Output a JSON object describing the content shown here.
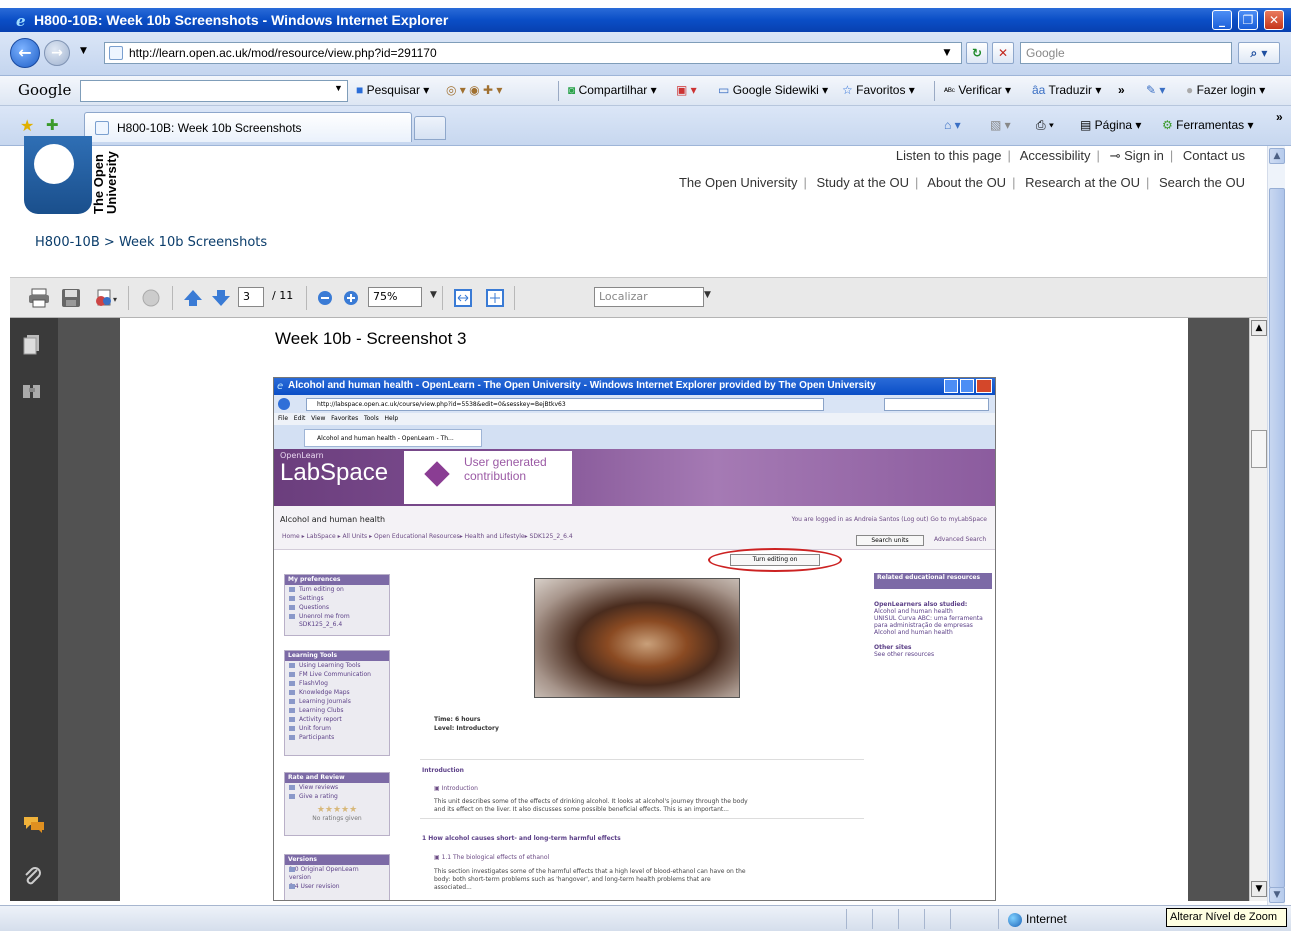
{
  "window": {
    "title": "H800-10B: Week 10b Screenshots - Windows Internet Explorer"
  },
  "address": {
    "url": "http://learn.open.ac.uk/mod/resource/view.php?id=291170",
    "search_placeholder": "Google"
  },
  "google_toolbar": {
    "logo": "Google",
    "items": [
      "Pesquisar",
      "Compartilhar",
      "Google Sidewiki",
      "Favoritos",
      "Verificar",
      "Traduzir",
      "Fazer login"
    ]
  },
  "tabs": {
    "active": "H800-10B: Week 10b Screenshots",
    "right_items": [
      "Página",
      "Ferramentas"
    ]
  },
  "ou_page": {
    "logo_text": "The Open University",
    "top_links": [
      "Listen to this page",
      "Accessibility",
      "Sign in",
      "Contact us"
    ],
    "main_links": [
      "The Open University",
      "Study at the OU",
      "About the OU",
      "Research at the OU",
      "Search the OU"
    ],
    "breadcrumb_course": "H800-10B",
    "breadcrumb_sep": ">",
    "breadcrumb_page": "Week 10b Screenshots"
  },
  "pdf_toolbar": {
    "page_current": "3",
    "page_total": "/ 11",
    "zoom": "75%",
    "find_placeholder": "Localizar"
  },
  "pdf_page": {
    "title": "Week 10b - Screenshot 3",
    "inner": {
      "window_title": "Alcohol and human health - OpenLearn - The Open University - Windows Internet Explorer provided by The Open University",
      "url": "http://labspace.open.ac.uk/course/view.php?id=5538&edit=0&sesskey=BejBtkv63",
      "menu": [
        "File",
        "Edit",
        "View",
        "Favorites",
        "Tools",
        "Help"
      ],
      "tab": "Alcohol and human health - OpenLearn - Th...",
      "brand_small": "OpenLearn",
      "brand": "LabSpace",
      "ugc": "User generated contribution",
      "course_title": "Alcohol and human health",
      "logged_in": "You are logged in as Andreia Santos (Log out)  Go to myLabSpace",
      "crumbs": "Home ▸ LabSpace ▸ All Units ▸ Open Educational Resources▸ Health and Lifestyle▸ SDK125_2_6.4",
      "search_units": "Search units",
      "advanced_search": "Advanced Search",
      "turn_editing": "Turn editing on",
      "pref_title": "My preferences",
      "pref_items": [
        "Turn editing on",
        "Settings",
        "Questions",
        "Unenrol me from SDK125_2_6.4"
      ],
      "tools_title": "Learning Tools",
      "tools_items": [
        "Using Learning Tools",
        "FM Live Communication",
        "FlashVlog",
        "Knowledge Maps",
        "Learning Journals",
        "Learning Clubs",
        "Activity report",
        "Unit forum",
        "Participants"
      ],
      "rate_title": "Rate and Review",
      "rate_items": [
        "View reviews",
        "Give a rating"
      ],
      "no_ratings": "No ratings given",
      "versions_title": "Versions",
      "versions_items": [
        "1.0 Original OpenLearn version",
        "6.4 User revision"
      ],
      "related_title": "Related educational resources",
      "also_title": "OpenLearners also studied:",
      "also_items": [
        "Alcohol and human health",
        "UNISUL Curva ABC: uma ferramenta para administração de empresas",
        "Alcohol and human health"
      ],
      "other_title": "Other sites",
      "other_link": "See other resources",
      "time": "Time: 6 hours",
      "level": "Level: Introductory",
      "intro_heading": "Introduction",
      "intro_link": "Introduction",
      "intro_text1": "This unit describes some of the effects of drinking alcohol. It looks at alcohol's journey through the body",
      "intro_text2": "and its effect on the liver. It also discusses some possible beneficial effects. This is an important...",
      "sec1_heading": "1 How alcohol causes short- and long-term harmful effects",
      "sec1_link": "1.1 The biological effects of ethanol",
      "sec1_text1": "This section investigates some of the harmful effects that a high level of blood-ethanol can have on the",
      "sec1_text2": "body: both short-term problems such as 'hangover', and long-term health problems that are",
      "sec1_text3": "associated..."
    }
  },
  "statusbar": {
    "zone": "Internet",
    "tooltip": "Alterar Nível de Zoom"
  }
}
